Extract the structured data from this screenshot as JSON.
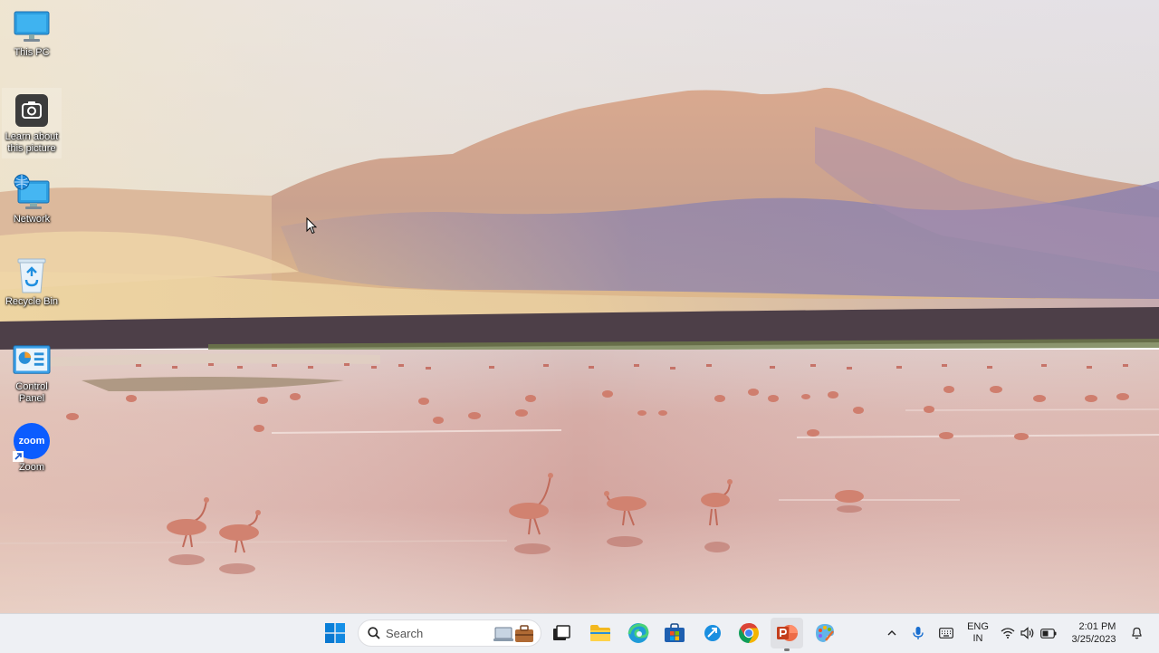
{
  "desktop": {
    "icons": [
      {
        "label": "This PC",
        "icon": "monitor-icon"
      },
      {
        "label": "Learn about this picture",
        "icon": "camera-icon"
      },
      {
        "label": "Network",
        "icon": "network-icon"
      },
      {
        "label": "Recycle Bin",
        "icon": "recycle-bin-icon"
      },
      {
        "label": "Control Panel",
        "icon": "control-panel-icon"
      },
      {
        "label": "Zoom",
        "icon": "zoom-icon",
        "badge_text": "zoom"
      }
    ]
  },
  "taskbar": {
    "search": {
      "placeholder": "Search"
    },
    "apps": [
      {
        "name": "start",
        "icon": "windows-logo-icon"
      },
      {
        "name": "search-highlight",
        "icon": "briefcase-icon"
      },
      {
        "name": "task-view",
        "icon": "task-view-icon"
      },
      {
        "name": "file-explorer",
        "icon": "folder-icon"
      },
      {
        "name": "edge",
        "icon": "edge-icon"
      },
      {
        "name": "store",
        "icon": "store-icon"
      },
      {
        "name": "quick-assist",
        "icon": "quick-assist-icon"
      },
      {
        "name": "chrome",
        "icon": "chrome-icon"
      },
      {
        "name": "powerpoint",
        "icon": "powerpoint-icon",
        "active": true
      },
      {
        "name": "paint",
        "icon": "paint-icon"
      }
    ],
    "tray": {
      "language_line1": "ENG",
      "language_line2": "IN",
      "time": "2:01 PM",
      "date": "3/25/2023"
    }
  },
  "colors": {
    "taskbar_bg": "#eef0f4",
    "accent": "#0078d4"
  }
}
